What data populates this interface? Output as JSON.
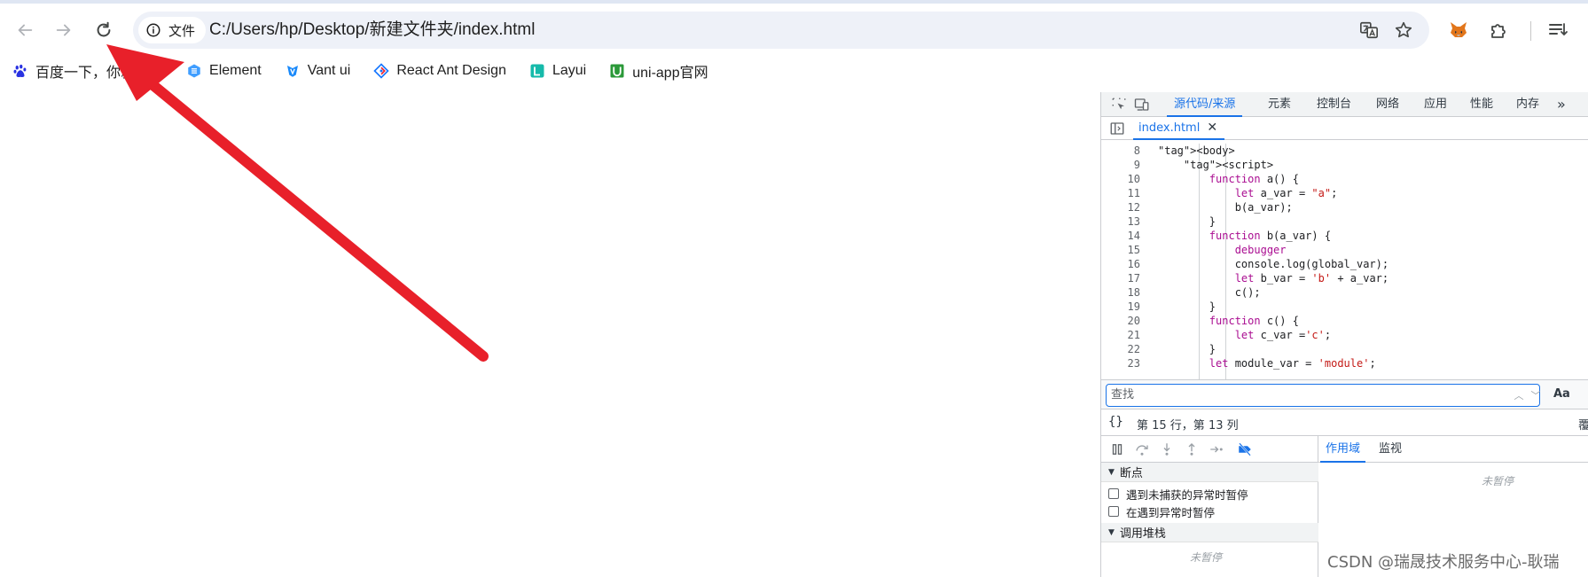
{
  "browser": {
    "address": {
      "site_chip_label": "文件",
      "url": "C:/Users/hp/Desktop/新建文件夹/index.html"
    },
    "icons": {
      "back": "back-arrow-icon",
      "forward": "forward-arrow-icon",
      "reload": "reload-icon",
      "info": "info-icon",
      "translate": "translate-icon",
      "bookmark_star": "star-icon",
      "metamask": "fox-icon",
      "extensions": "puzzle-icon",
      "reading_list": "reading-list-icon"
    }
  },
  "bookmarks": [
    {
      "label": "百度一下，你就知道",
      "icon": "baidu-paw-icon"
    },
    {
      "label": "Element",
      "icon": "element-icon"
    },
    {
      "label": "Vant ui",
      "icon": "vant-icon"
    },
    {
      "label": "React Ant Design",
      "icon": "antd-icon"
    },
    {
      "label": "Layui",
      "icon": "layui-icon"
    },
    {
      "label": "uni-app官网",
      "icon": "uniapp-icon"
    }
  ],
  "devtools": {
    "tabs": [
      "源代码/来源",
      "元素",
      "控制台",
      "网络",
      "应用",
      "性能",
      "内存"
    ],
    "active_tab": "源代码/来源",
    "more_tabs": "»",
    "file_tab": "index.html",
    "code_lines": [
      {
        "n": "8",
        "text": "<body>"
      },
      {
        "n": "9",
        "text": "    <script>"
      },
      {
        "n": "10",
        "text": "        function a() {"
      },
      {
        "n": "11",
        "text": "            let a_var = \"a\";"
      },
      {
        "n": "12",
        "text": "            b(a_var);"
      },
      {
        "n": "13",
        "text": "        }"
      },
      {
        "n": "14",
        "text": "        function b(a_var) {"
      },
      {
        "n": "15",
        "text": "            debugger"
      },
      {
        "n": "16",
        "text": "            console.log(global_var);"
      },
      {
        "n": "17",
        "text": "            let b_var = 'b' + a_var;"
      },
      {
        "n": "18",
        "text": "            c();"
      },
      {
        "n": "19",
        "text": "        }"
      },
      {
        "n": "20",
        "text": "        function c() {"
      },
      {
        "n": "21",
        "text": "            let c_var ='c';"
      },
      {
        "n": "22",
        "text": "        }"
      },
      {
        "n": "23",
        "text": "        let module_var = 'module';"
      }
    ],
    "search_placeholder": "查找",
    "case_toggle": "Aa",
    "braces": "{}",
    "cursor_position": "第 15 行，第 13 列",
    "cover_label": "覆",
    "sections": {
      "breakpoints": "断点",
      "pause_uncaught": "遇到未捕获的异常时暂停",
      "pause_caught": "在遇到异常时暂停",
      "call_stack": "调用堆栈",
      "not_paused": "未暂停"
    },
    "right_tabs": [
      "作用域",
      "监视"
    ],
    "right_not_paused": "未暂停"
  },
  "watermark": "CSDN @瑞晟技术服务中心-耿瑞",
  "annotation_arrow": {
    "color": "#e8202a"
  }
}
